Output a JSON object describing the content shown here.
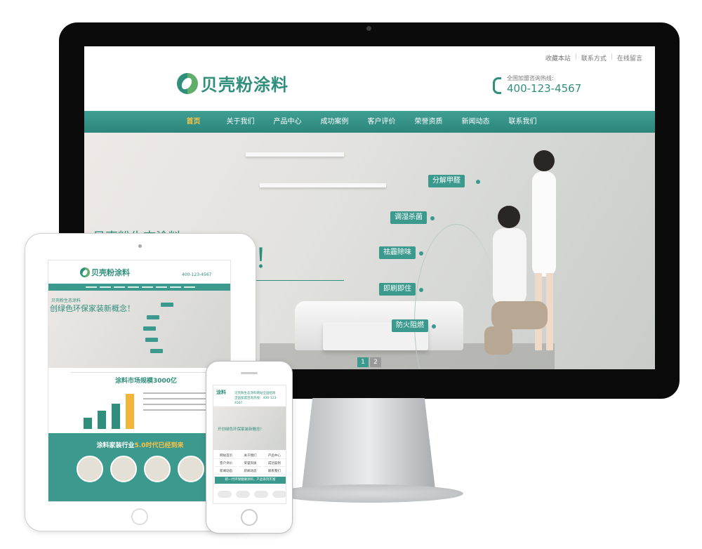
{
  "monitor": {
    "top_links": [
      "收藏本站",
      "联系方式",
      "在线留言"
    ],
    "logo_text": "贝壳粉涂料",
    "hotline_label": "全国加盟咨询热线:",
    "hotline_number": "400-123-4567",
    "nav": [
      "首页",
      "关于我们",
      "产品中心",
      "成功案例",
      "客户评价",
      "荣誉资质",
      "新闻动态",
      "联系我们"
    ],
    "nav_active_index": 0,
    "hero_small": "贝壳粉生态涂料",
    "hero_big": "装新概念！",
    "features": [
      "分解甲醛",
      "调湿杀菌",
      "祛霾除味",
      "即刷即住",
      "防火阻燃"
    ],
    "pager": [
      "1",
      "2"
    ],
    "pager_active_index": 0
  },
  "tablet": {
    "logo_text": "贝壳粉涂料",
    "hotline_number": "400-123-4567",
    "hero_small": "贝壳粉生态涂料",
    "hero_big": "创绿色环保家装新概念！",
    "market_title": "涂料市场规模3000亿",
    "band_title_prefix": "涂料家装行业",
    "band_title_highlight": "5.0时代已经到来"
  },
  "phone": {
    "logo_text": "涂料",
    "header_text": "贝壳粉生态涂料网站全国招商",
    "header_hotline": "全国加盟咨询热线：400-123-4567",
    "hero_text": "开创绿色环保家装新概念！",
    "menu": [
      "网站首页",
      "关于我们",
      "产品中心",
      "客户评价",
      "荣誉资质",
      "成功案例",
      "新闻动态",
      "新闻动态",
      "联系我们"
    ],
    "banner_text": "新一代环保健康涂料，产品系列丰富"
  },
  "colors": {
    "brand": "#2f8f7c",
    "nav_active": "#f7c24a"
  }
}
